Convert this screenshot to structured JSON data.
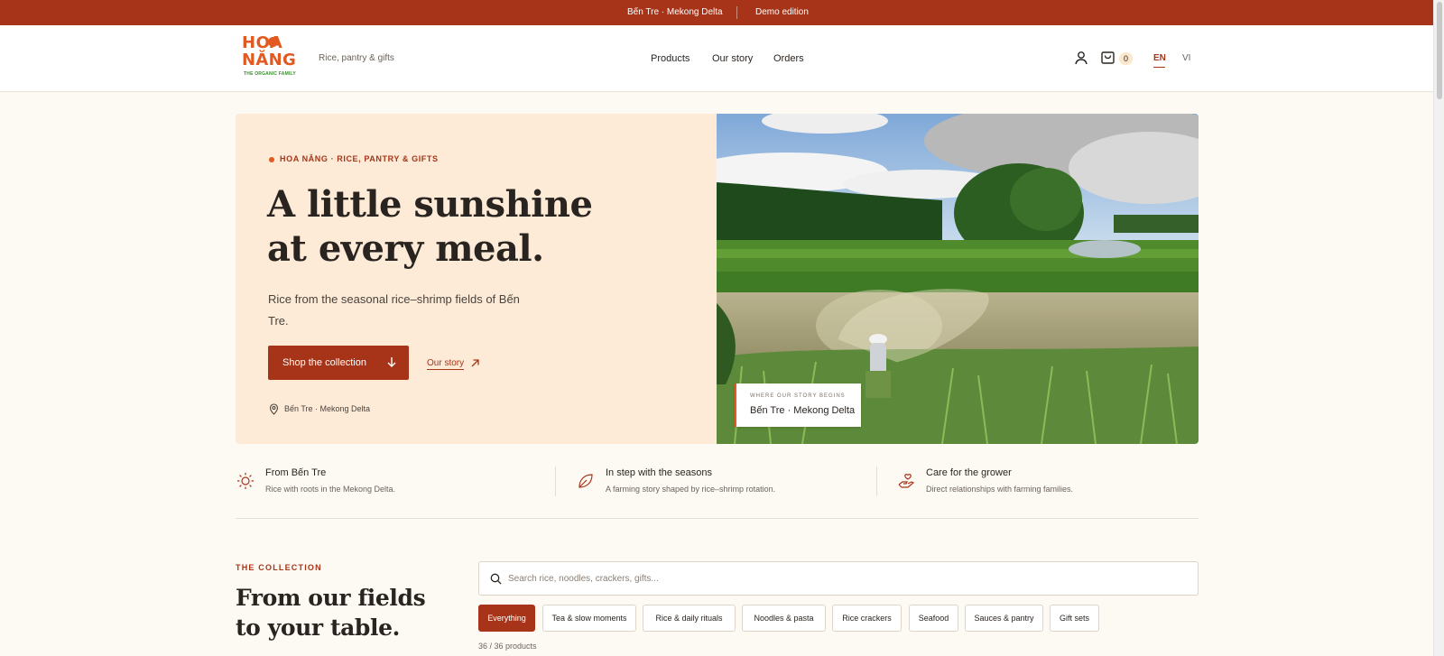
{
  "announcement": {
    "location": "Bến Tre · Mekong Delta",
    "edition": "Demo edition"
  },
  "header": {
    "logo": {
      "line1": "HOA",
      "line2": "NĂNG",
      "line3": "THE ORGANIC FAMILY"
    },
    "tagline": "Rice, pantry & gifts",
    "nav": {
      "products": "Products",
      "story": "Our story",
      "orders": "Orders"
    },
    "cart_count": "0",
    "lang_en": "EN",
    "lang_vi": "VI"
  },
  "hero": {
    "eyebrow": "HOA NĂNG · RICE, PANTRY & GIFTS",
    "title_line1": "A little sunshine",
    "title_line2": "at every meal.",
    "subtitle": "Rice from the seasonal rice–shrimp fields of Bến Tre.",
    "cta_label": "Shop the collection",
    "story_link": "Our story",
    "location": "Bến Tre · Mekong Delta",
    "photo_tag_kicker": "WHERE OUR STORY BEGINS",
    "photo_tag_place": "Bến Tre · Mekong Delta"
  },
  "features": [
    {
      "title": "From Bến Tre",
      "desc": "Rice with roots in the Mekong Delta.",
      "icon": "sun-icon"
    },
    {
      "title": "In step with the seasons",
      "desc": "A farming story shaped by rice–shrimp rotation.",
      "icon": "leaf-icon"
    },
    {
      "title": "Care for the grower",
      "desc": "Direct relationships with farming families.",
      "icon": "hand-heart-icon"
    }
  ],
  "collection": {
    "eyebrow": "THE COLLECTION",
    "title_line1": "From our fields",
    "title_line2": "to your table.",
    "search_placeholder": "Search rice, noodles, crackers, gifts...",
    "filters": [
      "Everything",
      "Tea & slow moments",
      "Rice & daily rituals",
      "Noodles & pasta",
      "Rice crackers",
      "Seafood",
      "Sauces & pantry",
      "Gift sets"
    ],
    "active_filter": "Everything",
    "count_text": "36 / 36 products"
  },
  "colors": {
    "brand": "#a73418",
    "accent": "#e25a22",
    "hero_bg": "#fdebd8",
    "page_bg": "#fdfaf4"
  }
}
